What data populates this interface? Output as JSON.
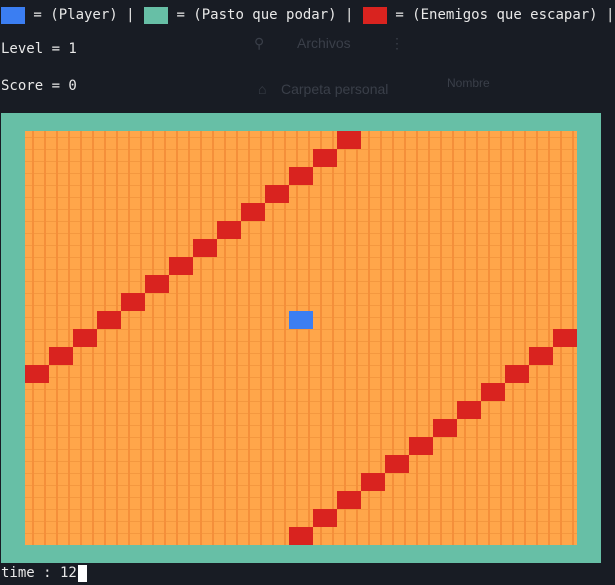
{
  "legend": {
    "player_swatch_color": "#3b7ef2",
    "player_text": " = (Player) | ",
    "grass_swatch_color": "#67bfa6",
    "grass_text": " = (Pasto que podar) | ",
    "enemy_swatch_color": "#d9231f",
    "enemy_text": " = (Enemigos que escapar) |"
  },
  "status": {
    "level_text": "Level = 1",
    "score_text": "Score = 0"
  },
  "background_window": {
    "search_label": "Archivos",
    "home_label": "Carpeta personal",
    "right_label": "Nombre"
  },
  "board": {
    "border_color": "#67bfa6",
    "field_color": "#ffa64a",
    "player": {
      "col": 11,
      "row": 10,
      "color": "#3b7ef2"
    },
    "enemy_color": "#d9231f",
    "enemies": [
      {
        "col": 13,
        "row": 0
      },
      {
        "col": 12,
        "row": 1
      },
      {
        "col": 11,
        "row": 2
      },
      {
        "col": 10,
        "row": 3
      },
      {
        "col": 9,
        "row": 4
      },
      {
        "col": 8,
        "row": 5
      },
      {
        "col": 7,
        "row": 6
      },
      {
        "col": 6,
        "row": 7
      },
      {
        "col": 5,
        "row": 8
      },
      {
        "col": 4,
        "row": 9
      },
      {
        "col": 3,
        "row": 10
      },
      {
        "col": 2,
        "row": 11
      },
      {
        "col": 1,
        "row": 12
      },
      {
        "col": 0,
        "row": 13
      },
      {
        "col": 22,
        "row": 11
      },
      {
        "col": 21,
        "row": 12
      },
      {
        "col": 20,
        "row": 13
      },
      {
        "col": 19,
        "row": 14
      },
      {
        "col": 18,
        "row": 15
      },
      {
        "col": 17,
        "row": 16
      },
      {
        "col": 16,
        "row": 17
      },
      {
        "col": 15,
        "row": 18
      },
      {
        "col": 14,
        "row": 19
      },
      {
        "col": 13,
        "row": 20
      },
      {
        "col": 12,
        "row": 21
      },
      {
        "col": 11,
        "row": 22
      }
    ]
  },
  "timer": {
    "label": "time : 12"
  }
}
